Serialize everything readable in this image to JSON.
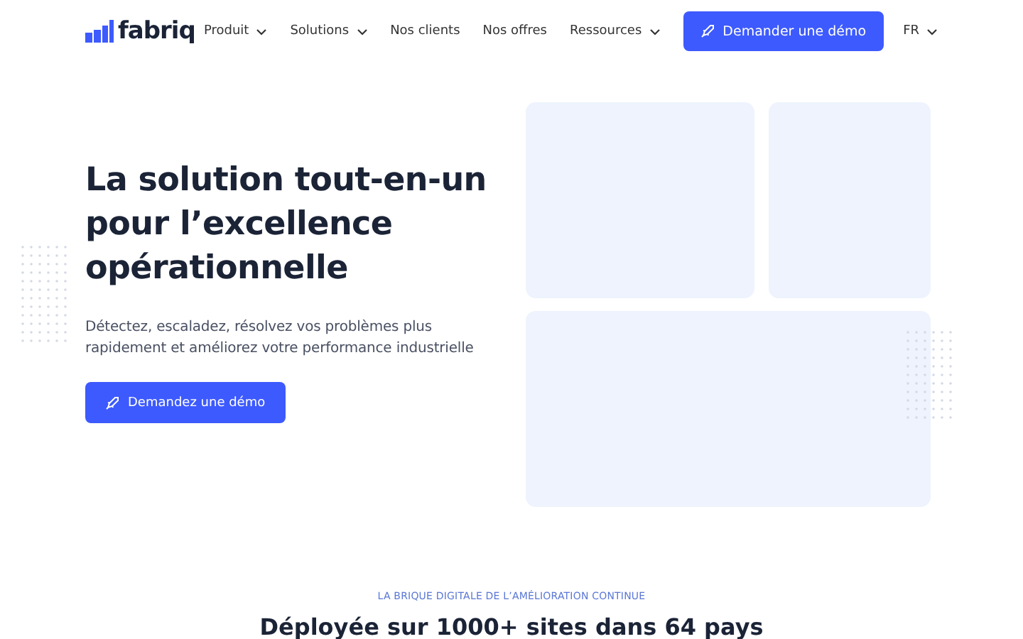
{
  "header": {
    "logo": "fabriq",
    "nav": [
      {
        "label": "Produit",
        "has_menu": true
      },
      {
        "label": "Solutions",
        "has_menu": true
      },
      {
        "label": "Nos clients",
        "has_menu": false
      },
      {
        "label": "Nos offres",
        "has_menu": false
      },
      {
        "label": "Ressources",
        "has_menu": true
      }
    ],
    "cta": "Demander une démo",
    "language": "FR"
  },
  "hero": {
    "title": "La solution tout-en-un pour l’excellence opérationnelle",
    "subtitle": "Détectez, escaladez, résolvez vos problèmes plus rapidement et améliorez votre performance industrielle",
    "cta": "Demandez une démo"
  },
  "section": {
    "eyebrow": "LA BRIQUE DIGITALE DE L’AMÉLIORATION CONTINUE",
    "heading": "Déployée sur 1000+ sites dans 64 pays"
  }
}
